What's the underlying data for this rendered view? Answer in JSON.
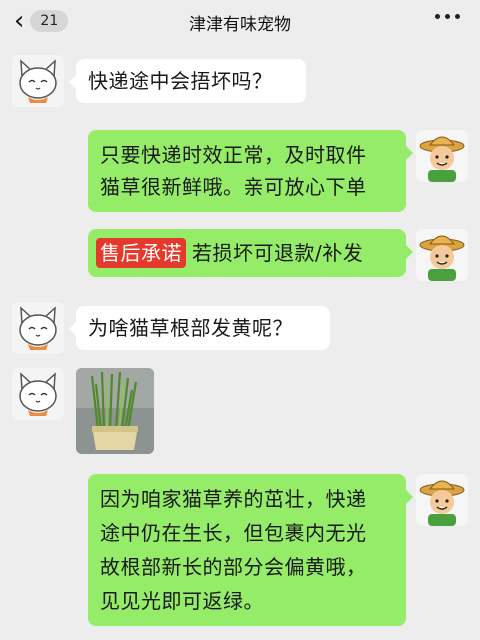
{
  "header": {
    "back_icon": "chevron-left-icon",
    "unread_count": "21",
    "title": "津津有味宠物",
    "more_icon": "more-dots-icon"
  },
  "messages": [
    {
      "side": "left",
      "avatar": "cat-avatar",
      "text": "快递途中会捂坏吗？"
    },
    {
      "side": "right",
      "avatar": "farmer-avatar",
      "line1": "只要快递时效正常，及时取件",
      "line2": "猫草很新鲜哦。亲可放心下单"
    },
    {
      "side": "right",
      "avatar": "farmer-avatar",
      "tag": "售后承诺",
      "text": "若损坏可退款/补发"
    },
    {
      "side": "left",
      "avatar": "cat-avatar",
      "text": "为啥猫草根部发黄呢？"
    },
    {
      "side": "left",
      "avatar": "cat-avatar",
      "type": "image",
      "image": "cat-grass-pot-photo"
    },
    {
      "side": "right",
      "avatar": "farmer-avatar",
      "line1": "因为咱家猫草养的茁壮，快递",
      "line2": "途中仍在生长，但包裹内无光",
      "line3": "故根部新长的部分会偏黄哦，",
      "line4": "见见光即可返绿。"
    }
  ],
  "colors": {
    "background": "#ededed",
    "right_bubble": "#95ec69",
    "left_bubble": "#ffffff",
    "tag": "#e53a2b"
  }
}
